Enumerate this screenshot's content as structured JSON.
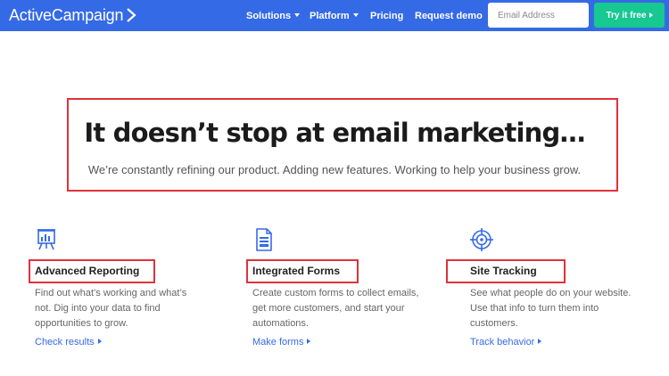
{
  "header": {
    "logo_text": "ActiveCampaign",
    "nav": [
      {
        "label": "Solutions",
        "has_caret": true
      },
      {
        "label": "Platform",
        "has_caret": true
      },
      {
        "label": "Pricing",
        "has_caret": false
      },
      {
        "label": "Request demo",
        "has_caret": false
      }
    ],
    "email_placeholder": "Email Address",
    "cta_label": "Try it free",
    "colors": {
      "bar": "#356ae6",
      "cta": "#17c891"
    }
  },
  "hero": {
    "title": "It doesn’t stop at email marketing…",
    "subtitle": "We’re constantly refining our product. Adding new features. Working to help your business grow."
  },
  "features": [
    {
      "icon": "presentation-chart-icon",
      "title": "Advanced Reporting",
      "description": "Find out what’s working and what’s not. Dig into your data to find opportunities to grow.",
      "link": "Check results"
    },
    {
      "icon": "form-document-icon",
      "title": "Integrated Forms",
      "description": "Create custom forms to collect emails, get more customers, and start your automations.",
      "link": "Make forms"
    },
    {
      "icon": "target-crosshair-icon",
      "title": "Site Tracking",
      "description": "See what people do on your website. Use that info to turn them into customers.",
      "link": "Track behavior"
    }
  ],
  "annotation_color": "#e0323c"
}
